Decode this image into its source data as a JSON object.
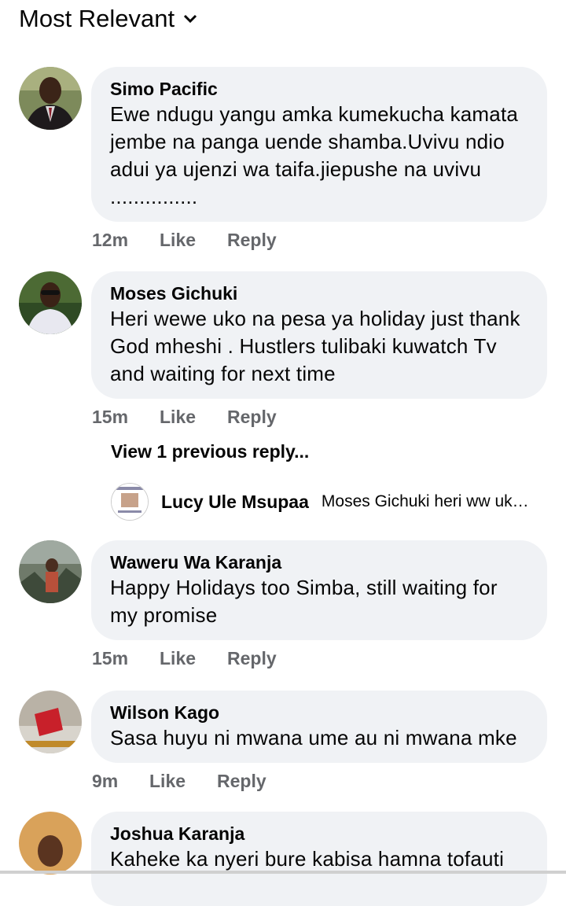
{
  "sort": {
    "label": "Most Relevant",
    "icon": "chevron-down-icon"
  },
  "comments": [
    {
      "name": "Simo Pacific",
      "text": "Ewe ndugu yangu amka kumekucha kamata jembe na panga uende shamba.Uvivu ndio adui ya ujenzi wa taifa.jiepushe na uvivu ...............",
      "time": "12m",
      "like": "Like",
      "reply": "Reply"
    },
    {
      "name": "Moses Gichuki",
      "text": "Heri wewe uko na pesa ya holiday just thank God mheshi . Hustlers tulibaki kuwatch Tv and waiting for next time",
      "time": "15m",
      "like": "Like",
      "reply": "Reply",
      "view_previous": "View 1 previous reply...",
      "latest_reply": {
        "name": "Lucy Ule Msupaa",
        "text": "Moses Gichuki heri ww uko…"
      }
    },
    {
      "name": "Waweru Wa Karanja",
      "text": "Happy Holidays too Simba, still waiting for my promise",
      "time": "15m",
      "like": "Like",
      "reply": "Reply"
    },
    {
      "name": "Wilson Kago",
      "text": "Sasa huyu ni mwana ume au ni mwana mke",
      "time": "9m",
      "like": "Like",
      "reply": "Reply"
    },
    {
      "name": "Joshua Karanja",
      "text": "Kaheke ka nyeri bure kabisa hamna tofauti"
    }
  ]
}
